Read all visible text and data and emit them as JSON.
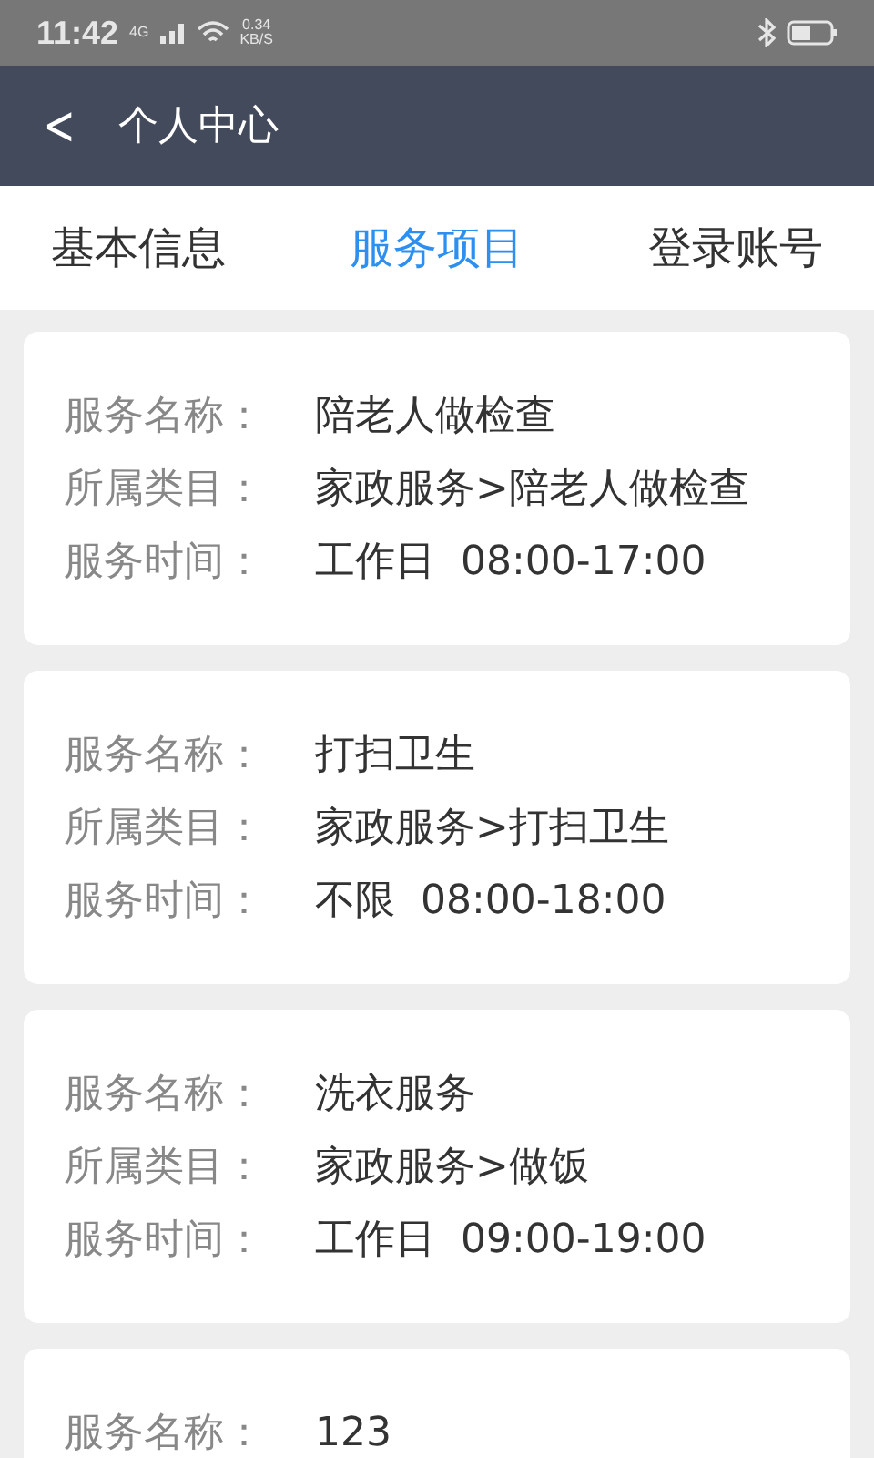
{
  "status_bar": {
    "time": "11:42",
    "network": "4G",
    "speed": "0.34",
    "speed_unit": "KB/S"
  },
  "header": {
    "back": "<",
    "title": "个人中心"
  },
  "tabs": [
    {
      "label": "基本信息",
      "selected": false
    },
    {
      "label": "服务项目",
      "selected": true
    },
    {
      "label": "登录账号",
      "selected": false
    }
  ],
  "services": [
    {
      "rows": [
        {
          "label": "服务名称：",
          "value": "陪老人做检查"
        },
        {
          "label": "所属类目：",
          "value": "家政服务>陪老人做检查"
        },
        {
          "label": "服务时间：",
          "value": "工作日  08:00-17:00"
        }
      ]
    },
    {
      "rows": [
        {
          "label": "服务名称：",
          "value": "打扫卫生"
        },
        {
          "label": "所属类目：",
          "value": "家政服务>打扫卫生"
        },
        {
          "label": "服务时间：",
          "value": "不限  08:00-18:00"
        }
      ]
    },
    {
      "rows": [
        {
          "label": "服务名称：",
          "value": "洗衣服务"
        },
        {
          "label": "所属类目：",
          "value": "家政服务>做饭"
        },
        {
          "label": "服务时间：",
          "value": "工作日  09:00-19:00"
        }
      ]
    },
    {
      "rows": [
        {
          "label": "服务名称：",
          "value": "123"
        }
      ]
    }
  ]
}
